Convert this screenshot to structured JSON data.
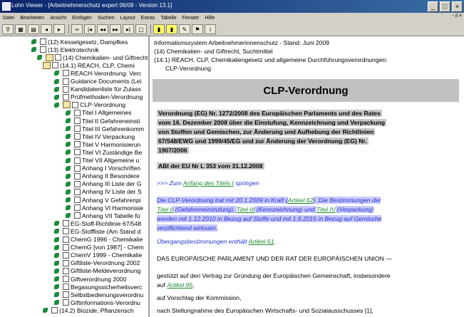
{
  "window": {
    "title": "Lohn Viewer - [Arbeitnehmerschutz expert 06/09 - Version 13.1]"
  },
  "menu": [
    "Datei",
    "Bearbeiten",
    "Ansicht",
    "Einfügen",
    "Suchen",
    "Layout",
    "Extras",
    "Tabelle",
    "Fenster",
    "Hilfe"
  ],
  "tree": [
    {
      "label": "(12) Kesselgesetz, Dampfkes"
    },
    {
      "label": "(13) Elektrotechnik"
    },
    {
      "label": "(14) Chemikalien- und Giftrecht"
    },
    {
      "label": "(14.1) REACH, CLP, Chemi"
    },
    {
      "label": "REACH-Verordnung: Verc"
    },
    {
      "label": "Guidance Documents (Lei"
    },
    {
      "label": "Kandidatenliste für Zulass"
    },
    {
      "label": "Prüfmethoden-Verordnung"
    },
    {
      "label": "CLP-Verordnung"
    },
    {
      "label": "Titel I  Allgemeines"
    },
    {
      "label": "Titel II  Gefahreneinsti"
    },
    {
      "label": "Titel III  Gefahrenkomm"
    },
    {
      "label": "Titel IV  Verpackung"
    },
    {
      "label": "Titel V  Harmonisierun"
    },
    {
      "label": "Titel VI  Zuständige Be"
    },
    {
      "label": "Titel VII  Allgemeine u"
    },
    {
      "label": "Anhang I  Vorschriften"
    },
    {
      "label": "Anhang II  Besondere"
    },
    {
      "label": "Anhang III  Liste der G"
    },
    {
      "label": "Anhang IV  Liste der S"
    },
    {
      "label": "Anhang V  Gefahrenpi"
    },
    {
      "label": "Anhang VI  Harmonisie"
    },
    {
      "label": "Anhang VII  Tabelle fü"
    },
    {
      "label": "EG-Stoff-Richtlinie 67/548"
    },
    {
      "label": "EG-Stoffliste (Am Stand d"
    },
    {
      "label": "ChemG 1996 - Chemikalie"
    },
    {
      "label": "ChemG [von 1987] - Chem"
    },
    {
      "label": "ChemV 1999 - Chemikalie"
    },
    {
      "label": "Giftliste-Verordnung 2002"
    },
    {
      "label": "Giftliste-Meldeverordnung"
    },
    {
      "label": "Giftverordnung 2000"
    },
    {
      "label": "Begasungssicherheitsverc"
    },
    {
      "label": "Selbstbedienungsverordnu"
    },
    {
      "label": "Giftinformations-Verordnu"
    },
    {
      "label": "(14.2) Biozide, Pflanzensch"
    }
  ],
  "doc": {
    "header1": "Informationssystem Arbeitnehmerinnenschutz - Stand: Juni 2009",
    "header2": "(14) Chemikalien- und Giftrecht, Suchtmittel",
    "header3": "(14.1) REACH, CLP, Chemikaliengesetz und allgemeine Durchführungsverordnungen:",
    "header4": "CLP-Verordnung",
    "title": "CLP-Verordnung",
    "intro1": "Verordnung (EG) Nr. 1272/2008 des Europäischen Parlaments und des Rates",
    "intro2": "vom 16. Dezember 2008 über die Einstufung, Kennzeichnung und Verpackung",
    "intro3": "von Stoffen und Gemischen, zur Änderung und Aufhebung der Richtlinien",
    "intro4": "67/548/EWG und 1999/45/EG und zur Änderung der Verordnung (EG) Nr.",
    "intro5": "1907/2006",
    "abl": "ABl der EU Nr L 353 vom 31.12.2008",
    "jump_prefix": ">>> Zum ",
    "jump_link": "Anfang des Titels I",
    "jump_suffix": " springen",
    "blue1a": "Die CLP-Verordnung trat mit 20.1.2009 in Kraft (",
    "blue1_link": "Artikel 62",
    "blue1b": "). Die Bestimmungen der",
    "blue2_link1": "Titel II",
    "blue2a": " (Gefahreneinstufung), ",
    "blue2_link2": "Titel III",
    "blue2b": " (Kennzeichnung) und ",
    "blue2_link3": "Titel IV",
    "blue2c": " (Verpackung)",
    "blue3": "werden mit 1.12.2010 in Bezug auf Stoffe und mit 1.6.2015 in Bezug auf Gemische",
    "blue4": "verpflichtend wirksam.",
    "trans_prefix": "Übergangsbestimmungen enthält ",
    "trans_link": "Artikel 61",
    "trans_suffix": ".",
    "eu_line": "DAS EUROPÄISCHE PARLAMENT UND DER RAT DER EUROPÄISCHEN UNION —",
    "p1a": "gestützt auf den Vertrag zur Gründung der Europäischen Gemeinschaft, insbesondere",
    "p1b_prefix": "auf ",
    "p1b_link": "Artikel 95",
    "p1b_suffix": ",",
    "p2": "auf Vorschlag der Kommission,",
    "p3": "nach Stellungnahme des Europäischen Wirtschafts- und Sozialausschusses [1],"
  }
}
